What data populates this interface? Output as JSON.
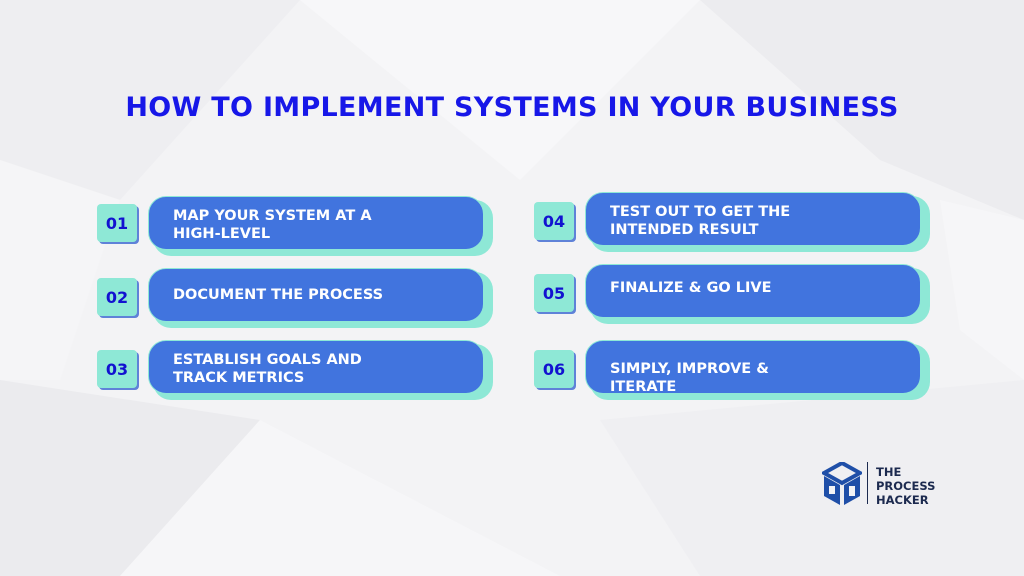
{
  "title": "HOW TO IMPLEMENT SYSTEMS IN YOUR BUSINESS",
  "colors": {
    "title": "#1717e8",
    "pill": "#4174de",
    "accent": "#8ee8d6",
    "number": "#1212d0"
  },
  "steps": [
    {
      "number": "01",
      "label": "MAP YOUR SYSTEM AT A HIGH-LEVEL"
    },
    {
      "number": "02",
      "label": "DOCUMENT THE PROCESS"
    },
    {
      "number": "03",
      "label": "ESTABLISH GOALS AND TRACK METRICS"
    },
    {
      "number": "04",
      "label": "TEST OUT TO GET THE INTENDED RESULT"
    },
    {
      "number": "05",
      "label": "FINALIZE & GO LIVE"
    },
    {
      "number": "06",
      "label": "SIMPLY, IMPROVE & ITERATE"
    }
  ],
  "brand": {
    "line1": "THE",
    "line2": "PROCESS",
    "line3": "HACKER",
    "icon": "cube-logo-icon"
  }
}
